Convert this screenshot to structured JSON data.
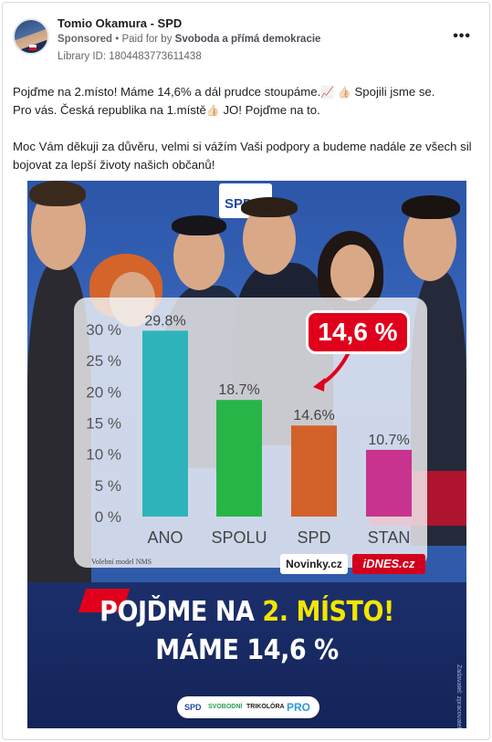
{
  "header": {
    "page_name": "Tomio Okamura - SPD",
    "sponsored": "Sponsored",
    "paid_for_prefix": " • Paid for by ",
    "payer": "Svoboda a přímá demokracie",
    "library_id": "Library ID: 1804483773611438",
    "more_icon": "more-horizontal-icon",
    "more_label": "•••"
  },
  "post": {
    "line1": "Pojďme na 2.místo! Máme 14,6% a dál prudce stoupáme.",
    "line1b": " Spojili jsme se.",
    "line2": "Pro vás. Česká republika na 1.místě",
    "line2b": " JO! Pojďme na to.",
    "para2": "Moc Vám děkuji za důvěru, velmi si vážím Vaši podpory a budeme nadále ze všech sil bojovat za lepší životy našich občanů!",
    "emoji_chart": "📈",
    "emoji_hand": "👍🏻",
    "emoji_hand2": "👍🏻"
  },
  "creative": {
    "sign_text": "SPD",
    "callout": "14,6 %",
    "source_note": "Volební model NMS",
    "novinky": "Novinky.cz",
    "idnes": "iDNES.cz",
    "headline1_a": "POJĎME NA ",
    "headline1_b": "2. MÍSTO!",
    "headline2": "MÁME 14,6 %",
    "logo_spd": "SPD",
    "logo_svobodni": "SVOBODNÍ",
    "logo_trikolora": "TRIKOLÓRA",
    "logo_pro": "PRO",
    "side_text": "Zadavatel: zpracovatel: SPD"
  },
  "chart_data": {
    "type": "bar",
    "categories": [
      "ANO",
      "SPOLU",
      "SPD",
      "STAN"
    ],
    "values": [
      29.8,
      18.7,
      14.6,
      10.7
    ],
    "value_labels": [
      "29.8%",
      "18.7%",
      "14.6%",
      "10.7%"
    ],
    "colors": [
      "#2fb3ba",
      "#27b548",
      "#d2612a",
      "#c7338f"
    ],
    "yticks": [
      0,
      5,
      10,
      15,
      20,
      25,
      30
    ],
    "ytick_labels": [
      "0 %",
      "5 %",
      "10 %",
      "15 %",
      "20 %",
      "25 %",
      "30 %"
    ],
    "ylim": [
      0,
      30
    ],
    "grid": false
  }
}
